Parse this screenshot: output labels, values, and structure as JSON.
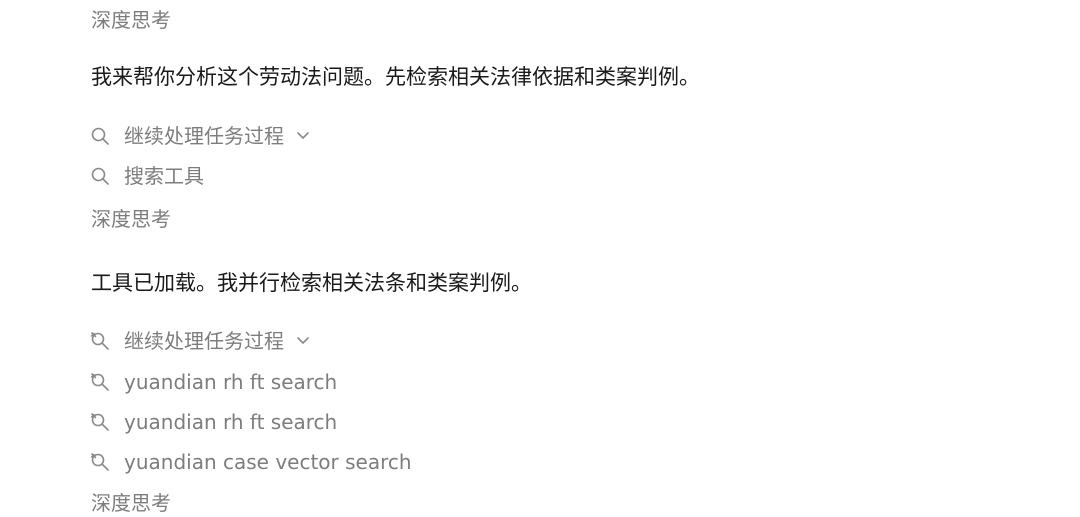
{
  "thinking_label": "深度思考",
  "messages": [
    "我来帮你分析这个劳动法问题。先检索相关法律依据和类案判例。",
    "工具已加载。我并行检索相关法条和类案判例。"
  ],
  "steps_group_1": [
    {
      "label": "继续处理任务过程",
      "icon": "search-icon",
      "expandable": true
    },
    {
      "label": "搜索工具",
      "icon": "search-icon",
      "expandable": false
    }
  ],
  "steps_group_2": [
    {
      "label": "继续处理任务过程",
      "icon": "wrench-search-icon",
      "expandable": true
    },
    {
      "label": "yuandian rh ft search",
      "icon": "wrench-search-icon",
      "expandable": false
    },
    {
      "label": "yuandian rh ft search",
      "icon": "wrench-search-icon",
      "expandable": false
    },
    {
      "label": "yuandian case vector search",
      "icon": "wrench-search-icon",
      "expandable": false
    }
  ],
  "colors": {
    "muted_text": "#7d7d7d",
    "body_text": "#1a1a1a",
    "background": "#ffffff"
  }
}
